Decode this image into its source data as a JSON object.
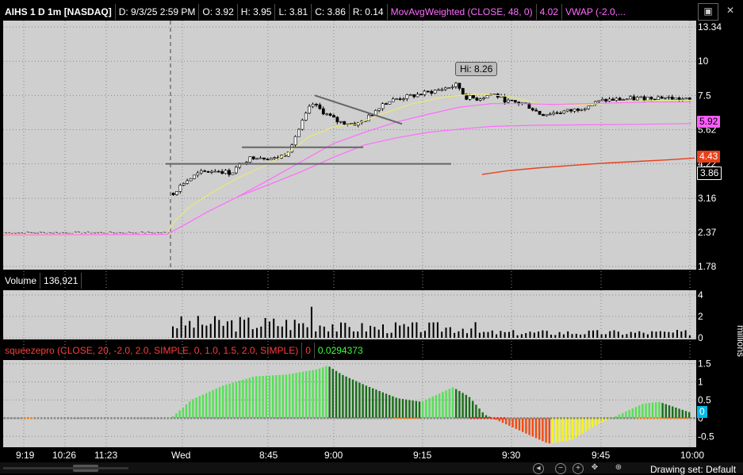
{
  "header": {
    "symbol": "AIHS 1 D 1m [NASDAQ]",
    "date": "D: 9/3/25 2:59 PM",
    "open": "O: 3.92",
    "high": "H: 3.95",
    "low": "L: 3.81",
    "close": "C: 3.86",
    "range": "R: 0.14",
    "wma_label": "MovAvgWeighted (CLOSE, 48, 0)",
    "wma_value": "4.02",
    "vwap_label": "VWAP (-2.0,..."
  },
  "volume_header": {
    "label": "Volume",
    "value": "136,921"
  },
  "squeeze_header": {
    "label": "squeezepro (CLOSE, 20, -2.0, 2.0, SIMPLE, 0, 1.0, 1.5, 2.0, SIMPLE)",
    "val1": "0",
    "val2": "0.0294373"
  },
  "price_axis": [
    "13.34",
    "10",
    "7.5",
    "5.62",
    "4.22",
    "3.16",
    "2.37",
    "1.78"
  ],
  "price_tags": [
    {
      "label": "5.92",
      "bg": "#ff5cff",
      "fg": "#000000"
    },
    {
      "label": "4.43",
      "bg": "#e8401c",
      "fg": "#ffffff"
    },
    {
      "label": "3.86",
      "bg": "#000000",
      "fg": "#ffffff"
    }
  ],
  "hi_label": "Hi: 8.26",
  "volume_axis": [
    "4",
    "2",
    "0"
  ],
  "volume_unit": "millions",
  "squeeze_axis": [
    "1.5",
    "1",
    "0.5",
    "0",
    "-0.5"
  ],
  "squeeze_zero_tag": "0",
  "time_labels": [
    "9:19",
    "10:26",
    "11:23",
    "Wed",
    "8:45",
    "9:00",
    "9:15",
    "9:30",
    "9:45",
    "10:00"
  ],
  "footer": {
    "drawing_set": "Drawing set: Default"
  },
  "colors": {
    "pane_bg": "#cfcfcf",
    "up_candle": "#ffffff",
    "down_candle": "#000000",
    "ema_yellow": "#e8e87a",
    "ema_magenta": "#ff6cff",
    "vwap_orange": "#e8401c",
    "sq_up_bright": "#55e055",
    "sq_up_dark": "#1a6e1a",
    "sq_down_red": "#f04a10",
    "sq_down_yellow": "#f5f520"
  },
  "chart_data": [
    {
      "type": "candlestick",
      "title": "AIHS 1 D 1m [NASDAQ]",
      "x": [
        "9:19",
        "10:26",
        "11:23",
        "Wed",
        "8:45",
        "9:00",
        "9:15",
        "9:30",
        "9:45",
        "10:00"
      ],
      "yticks": [
        13.34,
        10,
        7.5,
        5.62,
        4.22,
        3.16,
        2.37,
        1.78
      ],
      "ylim": [
        1.78,
        13.34
      ],
      "scale": "log",
      "series": [
        {
          "name": "MovAvgWeighted (CLOSE, 48, 0)",
          "last": 4.02
        },
        {
          "name": "VWAP",
          "last": 4.43
        }
      ],
      "annotations": [
        "Hi: 8.26",
        "5.92",
        "4.43",
        "3.86"
      ]
    },
    {
      "type": "bar",
      "title": "Volume",
      "last": 136921,
      "ylim": [
        0,
        4
      ],
      "ylabel": "millions"
    },
    {
      "type": "bar",
      "title": "squeezepro (CLOSE, 20, -2.0, 2.0, SIMPLE, 0, 1.0, 1.5, 2.0, SIMPLE)",
      "ylim": [
        -0.8,
        1.6
      ],
      "yticks": [
        1.5,
        1,
        0.5,
        0,
        -0.5
      ],
      "last": 0.0294373
    }
  ]
}
